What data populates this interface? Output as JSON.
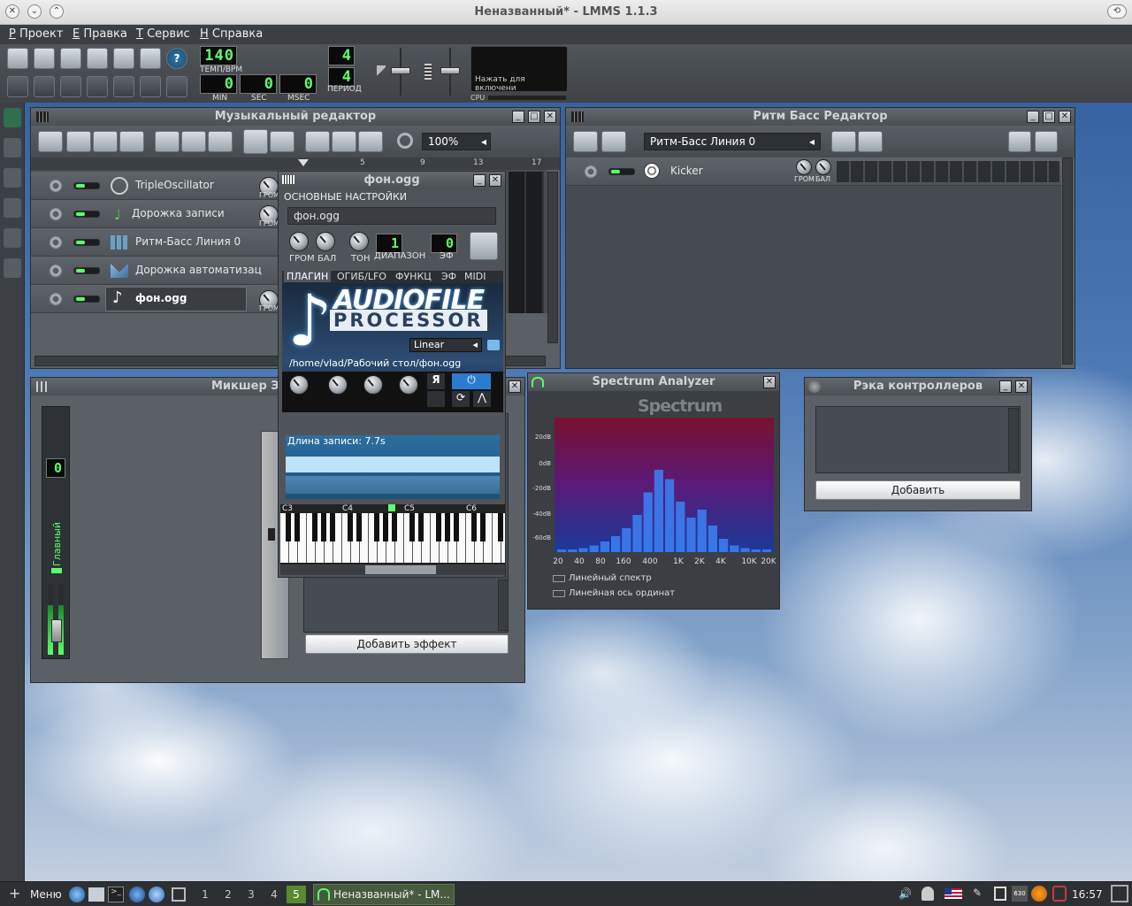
{
  "window": {
    "title": "Неназванный* - LMMS 1.1.3"
  },
  "menu": [
    "Проект",
    "Правка",
    "Сервис",
    "Справка"
  ],
  "menu_accels": [
    "P",
    "E",
    "T",
    "H"
  ],
  "toolbar": {
    "tempo": "140",
    "tempo_label": "ТЕМП/BPM",
    "min": "0",
    "sec": "0",
    "msec": "0",
    "min_label": "MIN",
    "sec_label": "SEC",
    "msec_label": "MSEC",
    "period_top": "4",
    "period_bottom": "4",
    "period_label": "ПЕРИОД",
    "cpu_label": "CPU",
    "cpu_hint": "Нажать для включени"
  },
  "song_editor": {
    "title": "Музыкальный редактор",
    "zoom": "100%",
    "ruler": [
      "5",
      "9",
      "13",
      "17"
    ],
    "tracks": [
      {
        "name": "TripleOscillator",
        "knob": "ГРОМ"
      },
      {
        "name": "Дорожка записи",
        "knob": "ГРОМ"
      },
      {
        "name": "Ритм-Басс Линия 0",
        "knob": ""
      },
      {
        "name": "Дорожка автоматизац",
        "knob": ""
      },
      {
        "name": "фон.ogg",
        "knob": "ГРОМ"
      }
    ]
  },
  "bb_editor": {
    "title": "Ритм Басс Редактор",
    "pattern": "Ритм-Басс Линия 0",
    "track": "Kicker",
    "vol_label": "ГРОМ",
    "pan_label": "БАЛ"
  },
  "mixer": {
    "title": "Микшер Эф",
    "channel": "Главный",
    "channel_num": "0",
    "add_effect": "Добавить эффект"
  },
  "instrument": {
    "title": "фон.ogg",
    "section": "ОСНОВНЫЕ НАСТРОЙКИ",
    "name": "фон.ogg",
    "knobs": [
      "ГРОМ",
      "БАЛ",
      "ТОН"
    ],
    "range_label": "ДИАПАЗОН",
    "range": "1",
    "fx_label": "ЭФ",
    "fx": "0",
    "tabs": [
      "ПЛАГИН",
      "ОГИБ/LFO",
      "ФУНКЦ",
      "ЭФ",
      "MIDI"
    ],
    "plugin_line1": "AUDIOFILE",
    "plugin_line2": "PROCESSOR",
    "interp": "Linear",
    "path": "/home/vlad/Рабочий стол/фон.ogg",
    "sample_len": "Длина записи: 7.7s",
    "keys": [
      "C3",
      "C4",
      "C5",
      "C6"
    ]
  },
  "spectrum": {
    "title": "Spectrum Analyzer",
    "logo": "Spectrum Analyzer",
    "db": [
      "20dB",
      "0dB",
      "-20dB",
      "-40dB",
      "-60dB"
    ],
    "freq": [
      "20",
      "40",
      "80",
      "160",
      "400",
      "1K",
      "2K",
      "4K",
      "10K",
      "20K"
    ],
    "opt1": "Линейный спектр",
    "opt2": "Линейная ось ординат",
    "bands": [
      0.02,
      0.02,
      0.03,
      0.05,
      0.08,
      0.12,
      0.18,
      0.28,
      0.45,
      0.62,
      0.55,
      0.38,
      0.26,
      0.32,
      0.2,
      0.1,
      0.05,
      0.03,
      0.02,
      0.02
    ]
  },
  "controller_rack": {
    "title": "Рэка контроллеров",
    "add": "Добавить"
  },
  "taskbar": {
    "menu": "Меню",
    "workspaces": [
      "1",
      "2",
      "3",
      "4",
      "5"
    ],
    "task": "Неназванный* - LM...",
    "clock": "16:57",
    "tray_badge": "630"
  }
}
